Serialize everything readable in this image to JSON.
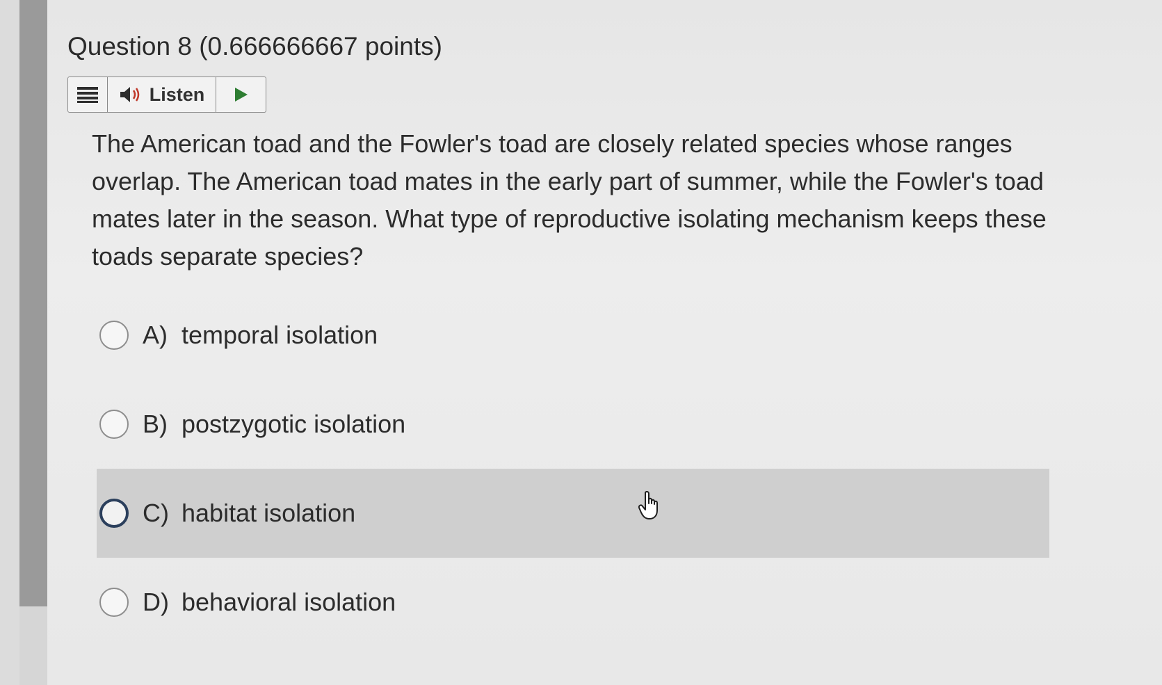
{
  "question": {
    "title": "Question 8 (0.666666667 points)",
    "text": "The American toad and the Fowler's toad are closely related species whose ranges overlap. The American toad mates in the early part of summer, while the Fowler's toad mates later in the season. What type of reproductive isolating mechanism keeps these toads separate species?"
  },
  "toolbar": {
    "menu_icon": "menu-icon",
    "speaker_icon": "speaker-icon",
    "listen_label": "Listen",
    "play_icon": "play-icon"
  },
  "options": [
    {
      "letter": "A)",
      "text": "temporal isolation",
      "highlighted": false
    },
    {
      "letter": "B)",
      "text": "postzygotic isolation",
      "highlighted": false
    },
    {
      "letter": "C)",
      "text": "habitat isolation",
      "highlighted": true
    },
    {
      "letter": "D)",
      "text": "behavioral isolation",
      "highlighted": false
    }
  ],
  "colors": {
    "highlight_bg": "#cfcfcf",
    "focused_radio_border": "#2b3f5c",
    "left_bar": "#9a9a9a",
    "play_green": "#2e7d32"
  }
}
